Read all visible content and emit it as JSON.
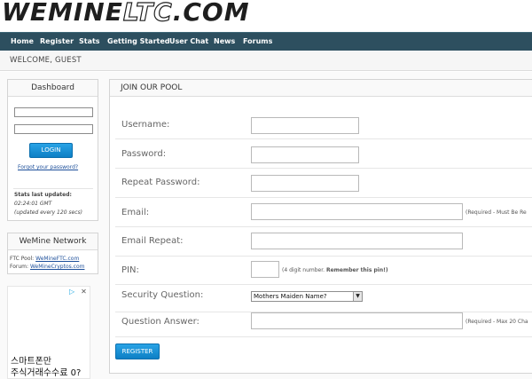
{
  "brand": {
    "logo_part1": "WEMINE",
    "logo_part2": "LTC",
    "logo_part3": ".COM"
  },
  "nav": {
    "items": [
      "Home",
      "Register",
      "Stats",
      "Getting Started",
      "User Chat",
      "News",
      "Forums"
    ]
  },
  "welcome": "WELCOME, GUEST",
  "dashboard": {
    "title": "Dashboard",
    "login_label": "LOGIN",
    "forgot_link": "Forgot your password?",
    "stats_title": "Stats last updated:",
    "stats_time": "02:24:01 GMT",
    "stats_note": "(updated every 120 secs)"
  },
  "network": {
    "title": "WeMine Network",
    "ftc_label": "FTC Pool:",
    "ftc_link": "WeMineFTC.com",
    "forum_label": "Forum:",
    "forum_link": "WeMineCryptos.com"
  },
  "ad": {
    "line1": "스마트폰만",
    "line2": "주식거래수수료 0?"
  },
  "form": {
    "title": "JOIN OUR POOL",
    "username_label": "Username:",
    "password_label": "Password:",
    "repeat_password_label": "Repeat Password:",
    "email_label": "Email:",
    "email_note": "(Required - Must Be Re",
    "email_repeat_label": "Email Repeat:",
    "pin_label": "PIN:",
    "pin_note": "(4 digit number.",
    "pin_note_bold": "Remember this pin!)",
    "security_label": "Security Question:",
    "security_selected": "Mothers Maiden Name?",
    "answer_label": "Question Answer:",
    "answer_note": "(Required - Max 20 Cha",
    "register_label": "REGISTER"
  }
}
